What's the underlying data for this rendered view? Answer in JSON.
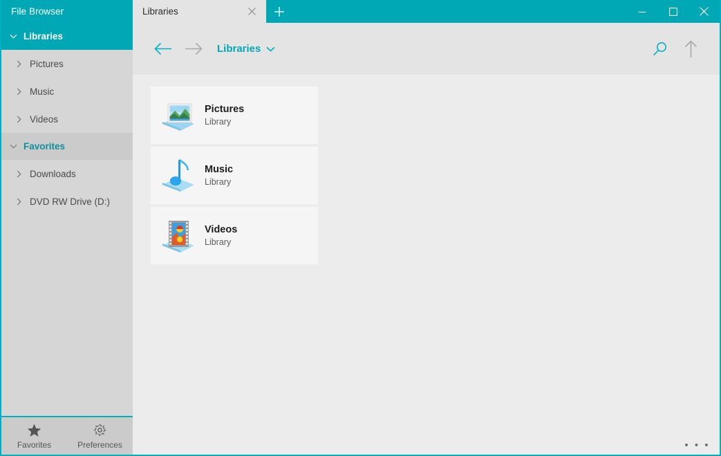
{
  "window": {
    "app_title": "File Browser",
    "accent_color": "#00a8b5",
    "border_color": "#00b0c0"
  },
  "tabs": [
    {
      "label": "Libraries",
      "close_icon": "close-icon",
      "active": true
    }
  ],
  "new_tab_button": {
    "label": "+",
    "icon": "plus-icon"
  },
  "window_controls": {
    "minimize": "minimize-icon",
    "maximize": "maximize-icon",
    "close": "close-icon"
  },
  "sidebar": {
    "groups": [
      {
        "label": "Libraries",
        "state": "active",
        "chevron": "chevron-down-icon",
        "items": [
          {
            "label": "Pictures",
            "chevron": "chevron-right-icon"
          },
          {
            "label": "Music",
            "chevron": "chevron-right-icon"
          },
          {
            "label": "Videos",
            "chevron": "chevron-right-icon"
          }
        ]
      },
      {
        "label": "Favorites",
        "state": "hover",
        "chevron": "chevron-down-icon",
        "items": [
          {
            "label": "Downloads",
            "chevron": "chevron-right-icon"
          },
          {
            "label": "DVD RW Drive (D:)",
            "chevron": "chevron-right-icon"
          }
        ]
      }
    ],
    "actions": [
      {
        "label": "Favorites",
        "icon": "star-icon"
      },
      {
        "label": "Preferences",
        "icon": "gear-icon"
      }
    ]
  },
  "toolbar": {
    "back": {
      "icon": "arrow-left-icon",
      "enabled": true
    },
    "forward": {
      "icon": "arrow-right-icon",
      "enabled": false
    },
    "breadcrumb": {
      "label": "Libraries",
      "chevron": "chevron-down-icon"
    },
    "search": {
      "icon": "search-icon"
    },
    "up": {
      "icon": "arrow-up-icon"
    }
  },
  "main": {
    "items": [
      {
        "title": "Pictures",
        "subtitle": "Library",
        "icon": "pictures-library-icon"
      },
      {
        "title": "Music",
        "subtitle": "Library",
        "icon": "music-library-icon"
      },
      {
        "title": "Videos",
        "subtitle": "Library",
        "icon": "videos-library-icon"
      }
    ]
  },
  "statusbar": {
    "overflow": "• • •"
  }
}
